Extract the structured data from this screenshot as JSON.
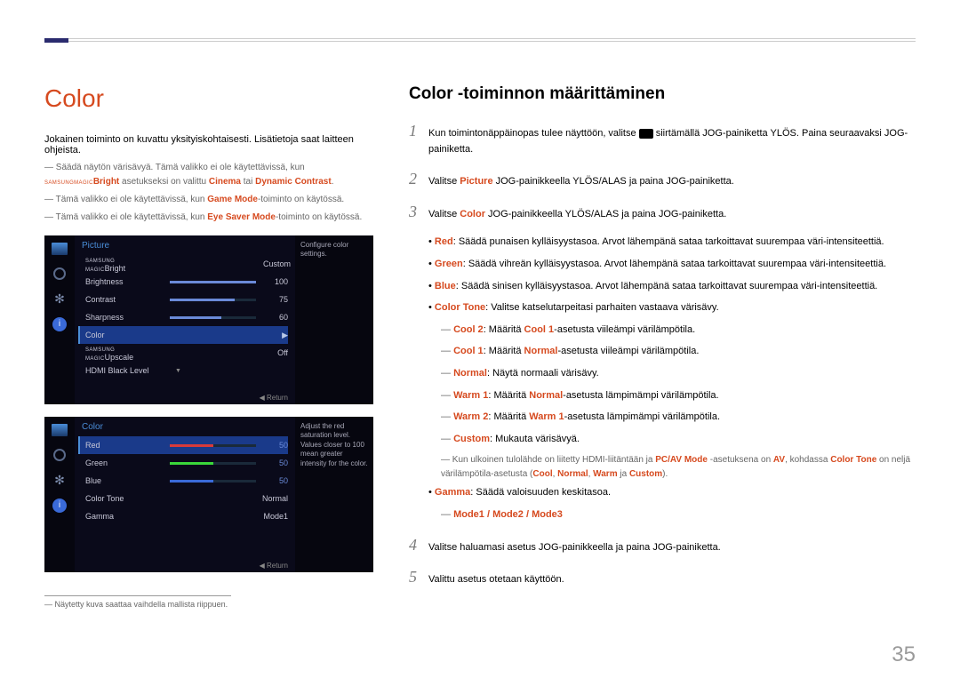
{
  "top": {
    "title": "Color",
    "subtitle": "Color -toiminnon määrittäminen"
  },
  "left": {
    "intro": "Jokainen toiminto on kuvattu yksityiskohtaisesti. Lisätietoja saat laitteen ohjeista.",
    "note1_a": "Säädä näytön värisävyä. Tämä valikko ei ole käytettävissä, kun ",
    "note1_brand1": "SAMSUNG",
    "note1_brand2": "MAGIC",
    "note1_brand3": "Bright",
    "note1_b": " asetukseksi on valittu ",
    "note1_c": "Cinema",
    "note1_d": " tai ",
    "note1_e": "Dynamic Contrast",
    "note2_a": "Tämä valikko ei ole käytettävissä, kun ",
    "note2_b": "Game Mode",
    "note2_c": "-toiminto on käytössä.",
    "note3_a": "Tämä valikko ei ole käytettävissä, kun ",
    "note3_b": "Eye Saver Mode",
    "note3_c": "-toiminto on käytössä.",
    "footnote": "Näytetty kuva saattaa vaihdella mallista riippuen."
  },
  "menu1": {
    "title": "Picture",
    "side": "Configure color settings.",
    "brand1": "SAMSUNG",
    "brand2": "MAGIC",
    "r1": "Bright",
    "v1": "Custom",
    "r2": "Brightness",
    "v2": "100",
    "r3": "Contrast",
    "v3": "75",
    "r4": "Sharpness",
    "v4": "60",
    "r5": "Color",
    "r6b": "Upscale",
    "v6": "Off",
    "r7": "HDMI Black Level",
    "return": "Return"
  },
  "menu2": {
    "title": "Color",
    "side": "Adjust the red saturation level. Values closer to 100 mean greater intensity for the color.",
    "r1": "Red",
    "v1": "50",
    "r2": "Green",
    "v2": "50",
    "r3": "Blue",
    "v3": "50",
    "r4": "Color Tone",
    "v4": "Normal",
    "r5": "Gamma",
    "v5": "Mode1",
    "return": "Return"
  },
  "steps": {
    "s1a": "Kun toimintonäppäinopas tulee näyttöön, valitse ",
    "s1b": " siirtämällä JOG-painiketta YLÖS. Paina seuraavaksi JOG-painiketta.",
    "s2a": "Valitse ",
    "s2b": "Picture",
    "s2c": " JOG-painikkeella YLÖS/ALAS ja paina JOG-painiketta.",
    "s3a": "Valitse ",
    "s3b": "Color",
    "s3c": " JOG-painikkeella YLÖS/ALAS ja paina JOG-painiketta.",
    "s4": "Valitse haluamasi asetus JOG-painikkeella ja paina JOG-painiketta.",
    "s5": "Valittu asetus otetaan käyttöön."
  },
  "bullets": {
    "red_l": "Red",
    "red_t": ": Säädä punaisen kylläisyystasoa. Arvot lähempänä sataa tarkoittavat suurempaa väri-intensiteettiä.",
    "green_l": "Green",
    "green_t": ": Säädä vihreän kylläisyystasoa. Arvot lähempänä sataa tarkoittavat suurempaa väri-intensiteettiä.",
    "blue_l": "Blue",
    "blue_t": ": Säädä sinisen kylläisyystasoa. Arvot lähempänä sataa tarkoittavat suurempaa väri-intensiteettiä.",
    "ct_l": "Color Tone",
    "ct_t": ": Valitse katselutarpeitasi parhaiten vastaava värisävy.",
    "c2a": "Cool 2",
    "c2b": ": Määritä ",
    "c2c": "Cool 1",
    "c2d": "-asetusta viileämpi värilämpötila.",
    "c1a": "Cool 1",
    "c1b": ": Määritä ",
    "c1c": "Normal",
    "c1d": "-asetusta viileämpi värilämpötila.",
    "na": "Normal",
    "nb": ": Näytä normaali värisävy.",
    "w1a": "Warm 1",
    "w1b": ": Määritä ",
    "w1c": "Normal",
    "w1d": "-asetusta lämpimämpi värilämpötila.",
    "w2a": "Warm 2",
    "w2b": ": Määritä ",
    "w2c": "Warm 1",
    "w2d": "-asetusta lämpimämpi värilämpötila.",
    "cua": "Custom",
    "cub": ": Mukauta värisävyä.",
    "note_a": "Kun ulkoinen tulolähde on liitetty HDMI-liitäntään ja ",
    "note_b": "PC/AV Mode",
    "note_c": " -asetuksena on ",
    "note_d": "AV",
    "note_e": ", kohdassa ",
    "note_f": "Color Tone",
    "note_g": " on neljä värilämpötila-asetusta (",
    "note_h": "Cool",
    "note_i": ", ",
    "note_j": "Normal",
    "note_k": ", ",
    "note_l": "Warm",
    "note_m": " ja ",
    "note_n": "Custom",
    "note_o": ").",
    "gm_l": "Gamma",
    "gm_t": ": Säädä valoisuuden keskitasoa.",
    "modes": "Mode1 / Mode2 / Mode3"
  },
  "pagenum": "35"
}
